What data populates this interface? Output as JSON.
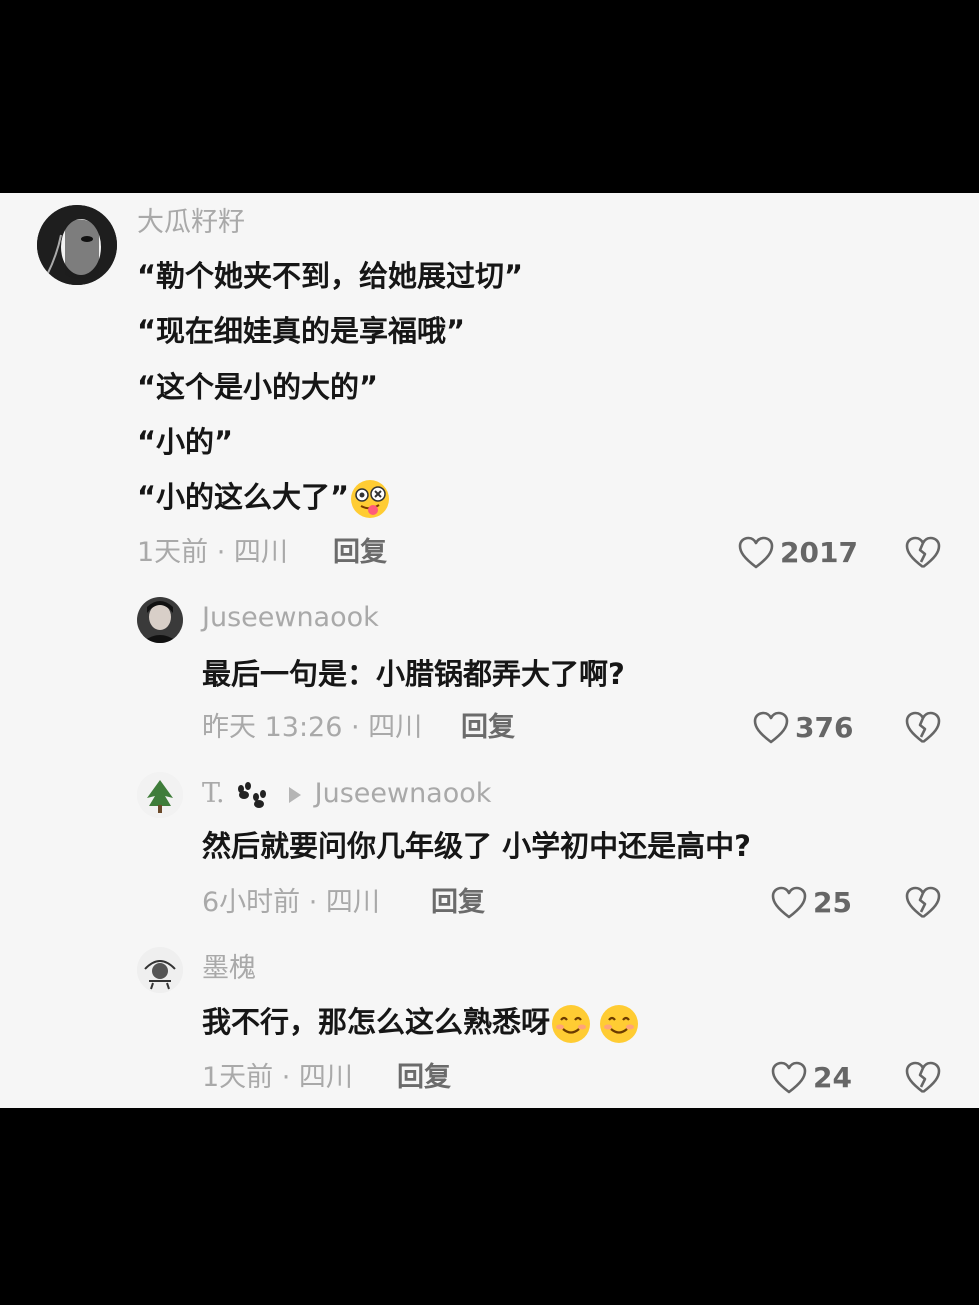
{
  "comments": [
    {
      "username": "大瓜籽籽",
      "lines": [
        "“勒个她夹不到，给她展过切”",
        "“现在细娃真的是享福哦”",
        "“这个是小的大的”",
        "“小的”",
        "“小的这么大了”"
      ],
      "emoji": "dizzy-tongue-emoji",
      "meta": "1天前 · 四川",
      "reply_label": "回复",
      "likes": "2017"
    },
    {
      "username": "Juseewnaook",
      "lines": [
        "最后一句是：小腊锅都弄大了啊?"
      ],
      "meta": "昨天 13:26 · 四川",
      "reply_label": "回复",
      "likes": "376"
    },
    {
      "username": "T.",
      "reply_to": "Juseewnaook",
      "lines": [
        "然后就要问你几年级了 小学初中还是高中?"
      ],
      "meta": "6小时前 · 四川",
      "reply_label": "回复",
      "likes": "25"
    },
    {
      "username": "墨槐",
      "lines": [
        "我不行，那怎么这么熟悉呀"
      ],
      "emoji": "smiling-emoji",
      "meta": "1天前 · 四川",
      "reply_label": "回复",
      "likes": "24"
    }
  ],
  "colors": {
    "background": "#f6f6f6",
    "letterbox": "#000000",
    "text": "#161616",
    "secondary": "#a9a9a9"
  }
}
